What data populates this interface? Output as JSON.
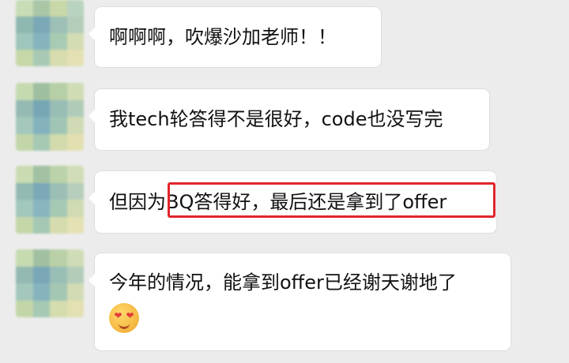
{
  "messages": [
    {
      "text": "啊啊啊，吹爆沙加老师！！"
    },
    {
      "text": "我tech轮答得不是很好，code也没写完"
    },
    {
      "text_before": "但因为",
      "text_highlight": "BQ答得好，最后还是拿到了offer"
    },
    {
      "text": "今年的情况，能拿到offer已经谢天谢地了",
      "emoji": "smiling-face-with-heart-eyes"
    }
  ],
  "highlight_color": "#e0262b",
  "bubble_color": "#ffffff",
  "background_color": "#ececec"
}
